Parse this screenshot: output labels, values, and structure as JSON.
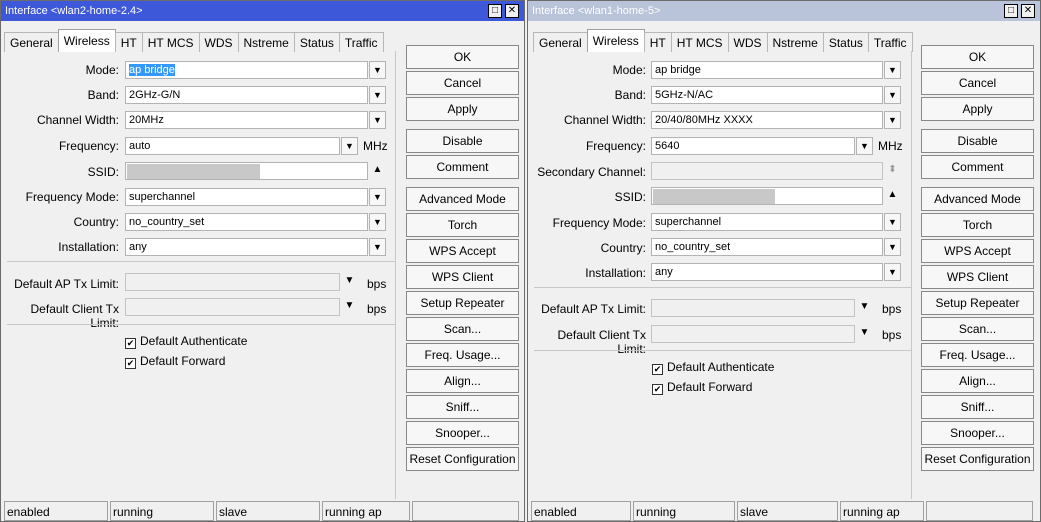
{
  "left": {
    "title": "Interface <wlan2-home-2.4>",
    "window_buttons": {
      "maximize": "□",
      "close": "✕"
    },
    "tabs": [
      "General",
      "Wireless",
      "HT",
      "HT MCS",
      "WDS",
      "Nstreme",
      "Status",
      "Traffic"
    ],
    "selected_tab": "Wireless",
    "fields": {
      "mode": {
        "label": "Mode:",
        "value": "ap bridge"
      },
      "band": {
        "label": "Band:",
        "value": "2GHz-G/N"
      },
      "channel_width": {
        "label": "Channel Width:",
        "value": "20MHz"
      },
      "frequency": {
        "label": "Frequency:",
        "value": "auto",
        "unit": "MHz"
      },
      "ssid": {
        "label": "SSID:",
        "value": ""
      },
      "frequency_mode": {
        "label": "Frequency Mode:",
        "value": "superchannel"
      },
      "country": {
        "label": "Country:",
        "value": "no_country_set"
      },
      "installation": {
        "label": "Installation:",
        "value": "any"
      },
      "default_ap_tx_limit": {
        "label": "Default AP Tx Limit:",
        "value": "",
        "unit": "bps"
      },
      "default_client_tx_limit": {
        "label": "Default Client Tx Limit:",
        "value": "",
        "unit": "bps"
      }
    },
    "checkboxes": {
      "default_authenticate": {
        "label": "Default Authenticate",
        "checked": true
      },
      "default_forward": {
        "label": "Default Forward",
        "checked": true
      }
    },
    "buttons": [
      "OK",
      "Cancel",
      "Apply",
      "Disable",
      "Comment",
      "Advanced Mode",
      "Torch",
      "WPS Accept",
      "WPS Client",
      "Setup Repeater",
      "Scan...",
      "Freq. Usage...",
      "Align...",
      "Sniff...",
      "Snooper...",
      "Reset Configuration"
    ],
    "status": [
      "enabled",
      "running",
      "slave",
      "running ap",
      ""
    ]
  },
  "right": {
    "title": "Interface <wlan1-home-5>",
    "window_buttons": {
      "maximize": "□",
      "close": "✕"
    },
    "tabs": [
      "General",
      "Wireless",
      "HT",
      "HT MCS",
      "WDS",
      "Nstreme",
      "Status",
      "Traffic"
    ],
    "selected_tab": "Wireless",
    "fields": {
      "mode": {
        "label": "Mode:",
        "value": "ap bridge"
      },
      "band": {
        "label": "Band:",
        "value": "5GHz-N/AC"
      },
      "channel_width": {
        "label": "Channel Width:",
        "value": "20/40/80MHz XXXX"
      },
      "frequency": {
        "label": "Frequency:",
        "value": "5640",
        "unit": "MHz"
      },
      "secondary_channel": {
        "label": "Secondary Channel:",
        "value": ""
      },
      "ssid": {
        "label": "SSID:",
        "value": ""
      },
      "frequency_mode": {
        "label": "Frequency Mode:",
        "value": "superchannel"
      },
      "country": {
        "label": "Country:",
        "value": "no_country_set"
      },
      "installation": {
        "label": "Installation:",
        "value": "any"
      },
      "default_ap_tx_limit": {
        "label": "Default AP Tx Limit:",
        "value": "",
        "unit": "bps"
      },
      "default_client_tx_limit": {
        "label": "Default Client Tx Limit:",
        "value": "",
        "unit": "bps"
      }
    },
    "checkboxes": {
      "default_authenticate": {
        "label": "Default Authenticate",
        "checked": true
      },
      "default_forward": {
        "label": "Default Forward",
        "checked": true
      }
    },
    "buttons": [
      "OK",
      "Cancel",
      "Apply",
      "Disable",
      "Comment",
      "Advanced Mode",
      "Torch",
      "WPS Accept",
      "WPS Client",
      "Setup Repeater",
      "Scan...",
      "Freq. Usage...",
      "Align...",
      "Sniff...",
      "Snooper...",
      "Reset Configuration"
    ],
    "status": [
      "enabled",
      "running",
      "slave",
      "running ap",
      ""
    ]
  },
  "glyphs": {
    "dropdown": "▼",
    "collapse": "▲",
    "updown": "⬍",
    "check": "✔"
  }
}
